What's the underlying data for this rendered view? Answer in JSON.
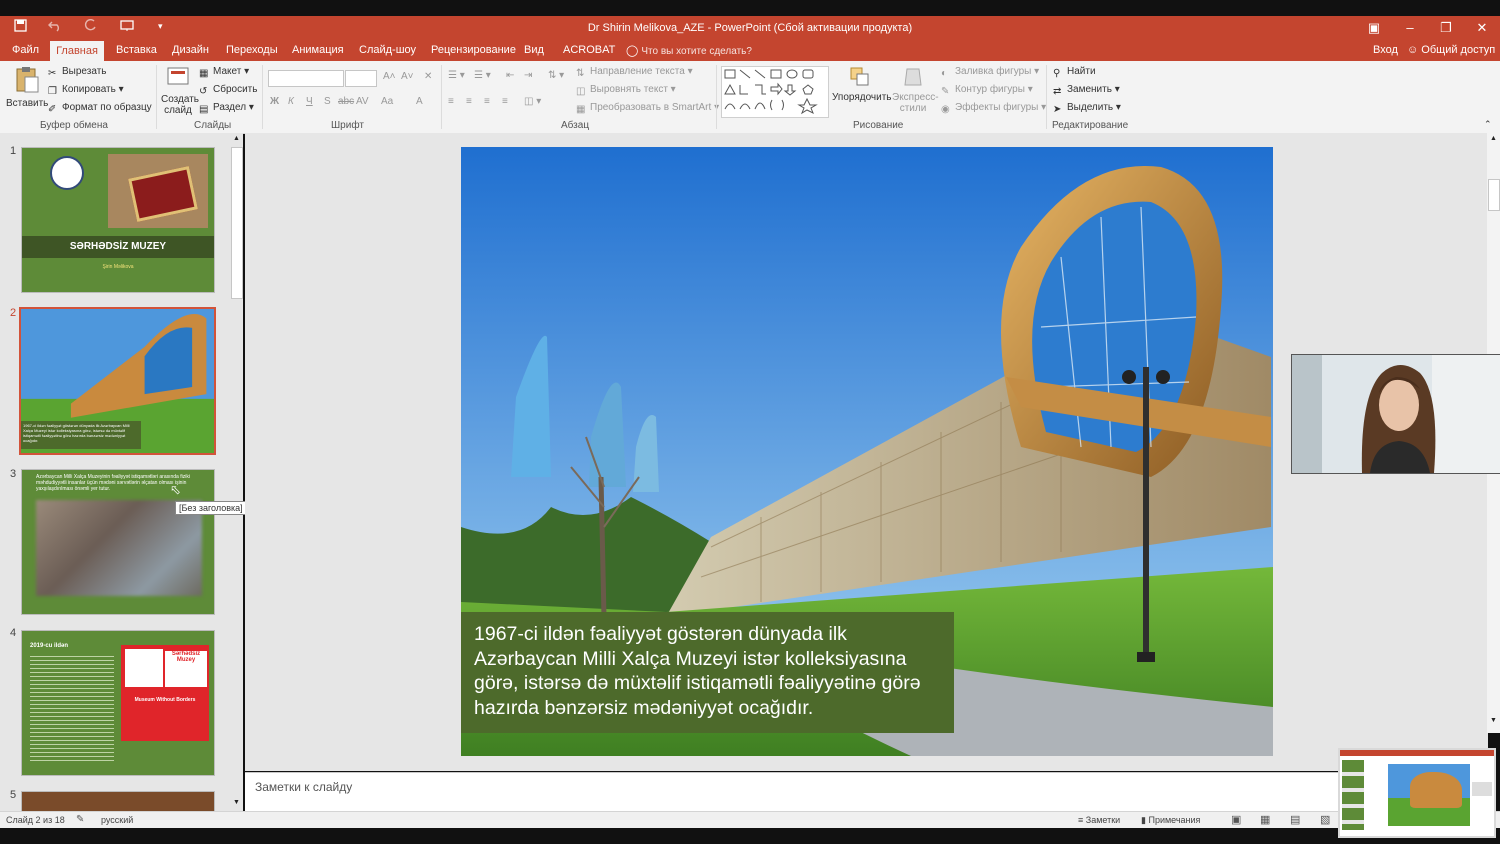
{
  "window": {
    "title": "Dr Shirin Melikova_AZE - PowerPoint (Сбой активации продукта)",
    "controls": [
      "▣",
      "–",
      "❐",
      "✕"
    ]
  },
  "menu": {
    "file": "Файл",
    "tabs": [
      "Главная",
      "Вставка",
      "Дизайн",
      "Переходы",
      "Анимация",
      "Слайд-шоу",
      "Рецензирование",
      "Вид",
      "ACROBAT"
    ],
    "tell_me": "Что вы хотите сделать?",
    "sign_in": "Вход",
    "share": "Общий доступ"
  },
  "ribbon": {
    "clipboard": {
      "paste": "Вставить",
      "cut": "Вырезать",
      "copy": "Копировать",
      "format_painter": "Формат по образцу",
      "label": "Буфер обмена"
    },
    "slides": {
      "new_slide": "Создать слайд",
      "layout": "Макет",
      "reset": "Сбросить",
      "section": "Раздел",
      "label": "Слайды"
    },
    "font": {
      "label": "Шрифт",
      "bold": "Ж",
      "italic": "К",
      "underline": "Ч",
      "shadow": "S",
      "strike": "abc",
      "spacing": "AV",
      "case": "Aa",
      "color": "A",
      "grow": "A˄",
      "shrink": "A˅"
    },
    "paragraph": {
      "label": "Абзац",
      "direction": "Направление текста",
      "align": "Выровнять текст",
      "smartart": "Преобразовать в SmartArt"
    },
    "drawing": {
      "label": "Рисование",
      "arrange": "Упорядочить",
      "quick_styles": "Экспресс-стили",
      "fill": "Заливка фигуры",
      "outline": "Контур фигуры",
      "effects": "Эффекты фигуры"
    },
    "editing": {
      "label": "Редактирование",
      "find": "Найти",
      "replace": "Заменить",
      "select": "Выделить"
    }
  },
  "thumbnails": [
    {
      "num": "1",
      "title": "SƏRHƏDSİZ MUZEY",
      "subtitle": "Şirin Məlikova"
    },
    {
      "num": "2",
      "caption": "1967-ci ildən fəaliyyət göstərən dünyada ilk Azərbaycan Milli Xalça Muzeyi istər kolleksiyasına görə, istərsə də müxtəlif istiqamətli fəaliyyətinə görə hazırda bənzərsiz mədəniyyət ocağıdır."
    },
    {
      "num": "3",
      "caption": "Azərbaycan Milli Xalça Muzeyinin fəaliyyət istiqamətləri arasında fiziki məhdudiyyətli insanlar üçün mədəni sərvətlərin əlçatan olması işinin yaxşılaşdırılması önəmli yer tutur."
    },
    {
      "num": "4",
      "heading": "2019-cu ildən",
      "badge_title": "Sərhədsiz Muzey",
      "badge_sub": "Museum Without Borders"
    },
    {
      "num": "5"
    }
  ],
  "tooltip": "[Без заголовка]",
  "slide": {
    "caption": "1967-ci ildən fəaliyyət göstərən dünyada ilk Azərbaycan Milli Xalça Muzeyi istər kolleksiyasına görə, istərsə də müxtəlif istiqamətli fəaliyyətinə görə hazırda bənzərsiz mədəniyyət ocağıdır."
  },
  "notes_placeholder": "Заметки к слайду",
  "status": {
    "slide_counter": "Слайд 2 из 18",
    "language": "русский",
    "notes_btn": "Заметки",
    "comments_btn": "Примечания"
  },
  "colors": {
    "accent": "#c4452f",
    "slide_green": "#5e8b38",
    "caption_bg": "#4d6a2b"
  }
}
